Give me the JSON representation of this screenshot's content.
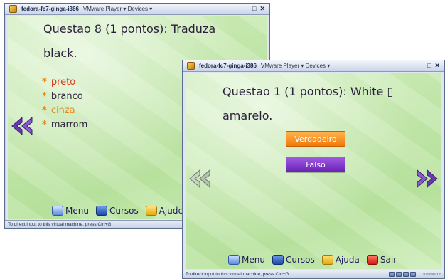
{
  "left_window": {
    "title": "fedora-fc7-ginga-i386",
    "menu": "VMware Player ▾  Devices ▾",
    "controls": {
      "minimize": "_",
      "maximize": "□",
      "close": "✕"
    },
    "question": "Questao 8 (1 pontos): Traduza black.",
    "options": [
      {
        "star": "*",
        "text": "preto"
      },
      {
        "star": "*",
        "text": "branco"
      },
      {
        "star": "*",
        "text": "cinza"
      },
      {
        "star": "*",
        "text": "marrom"
      }
    ],
    "footer": {
      "menu": "Menu",
      "cursos": "Cursos",
      "ajuda": "Ajudc"
    },
    "status": "To direct input to this virtual machine, press Ctrl+G"
  },
  "right_window": {
    "title": "fedora-fc7-ginga-i386",
    "menu": "VMware Player ▾  Devices ▾",
    "controls": {
      "minimize": "_",
      "maximize": "□",
      "close": "✕"
    },
    "question": "Questao 1 (1 pontos): White ▯ amarelo.",
    "buttons": {
      "true_label": "Verdadeiro",
      "false_label": "Falso"
    },
    "footer": {
      "menu": "Menu",
      "cursos": "Cursos",
      "ajuda": "Ajuda",
      "sair": "Sair"
    },
    "status": "To direct input to this virtual machine, press Ctrl+G",
    "brand": "vmware"
  },
  "colors": {
    "question_text": "#2b1f3a",
    "option_star": "#e28a1e",
    "option_highlight_red": "#d63a1a",
    "option_highlight_orange": "#e28a1e",
    "button_true": "#f07a0a",
    "button_false": "#6b22b8",
    "arrow": "#6a3bb0",
    "content_background": "#c4e8ad"
  },
  "icons": {
    "prev": "double-chevron-left-icon",
    "next": "double-chevron-right-icon"
  }
}
